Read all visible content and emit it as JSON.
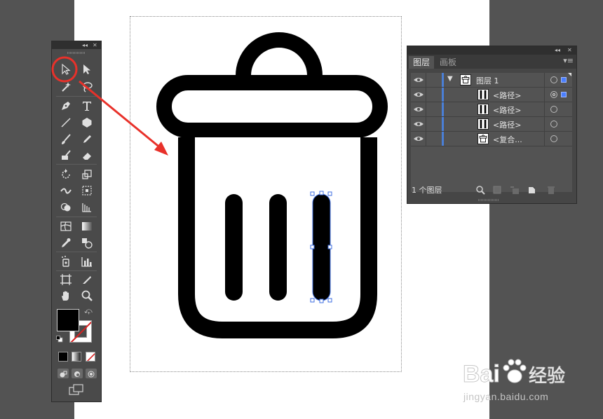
{
  "tools_panel": {
    "collapse_glyph": "◂◂",
    "close_glyph": "✕",
    "tools": [
      {
        "name": "selection-tool",
        "icon": "arrow-pointer"
      },
      {
        "name": "direct-selection-tool",
        "icon": "white-arrow"
      },
      {
        "name": "magic-wand-tool",
        "icon": "wand"
      },
      {
        "name": "lasso-tool",
        "icon": "lasso"
      },
      {
        "name": "pen-tool",
        "icon": "pen-nib"
      },
      {
        "name": "type-tool",
        "icon": "T"
      },
      {
        "name": "line-tool",
        "icon": "line"
      },
      {
        "name": "polygon-tool",
        "icon": "hexagon"
      },
      {
        "name": "paintbrush-tool",
        "icon": "brush"
      },
      {
        "name": "pencil-tool",
        "icon": "pencil"
      },
      {
        "name": "blob-brush-tool",
        "icon": "blob-brush"
      },
      {
        "name": "eraser-tool",
        "icon": "eraser"
      },
      {
        "name": "rotate-tool",
        "icon": "rotate"
      },
      {
        "name": "scale-tool",
        "icon": "scale"
      },
      {
        "name": "width-tool",
        "icon": "width"
      },
      {
        "name": "free-transform-tool",
        "icon": "free-transform"
      },
      {
        "name": "shape-builder-tool",
        "icon": "shape-builder"
      },
      {
        "name": "perspective-grid-tool",
        "icon": "perspective-grid"
      },
      {
        "name": "mesh-tool",
        "icon": "mesh"
      },
      {
        "name": "gradient-tool",
        "icon": "gradient"
      },
      {
        "name": "eyedropper-tool",
        "icon": "eyedropper"
      },
      {
        "name": "blend-tool",
        "icon": "blend"
      },
      {
        "name": "symbol-sprayer-tool",
        "icon": "symbol-sprayer"
      },
      {
        "name": "column-graph-tool",
        "icon": "column-graph"
      },
      {
        "name": "artboard-tool",
        "icon": "artboard"
      },
      {
        "name": "slice-tool",
        "icon": "slice"
      },
      {
        "name": "hand-tool",
        "icon": "hand"
      },
      {
        "name": "zoom-tool",
        "icon": "magnifier"
      }
    ],
    "fill_color": "#000000",
    "stroke_color": "none"
  },
  "layers_panel": {
    "collapse_glyph": "◂◂",
    "close_glyph": "✕",
    "tabs": [
      {
        "label": "图层",
        "active": true
      },
      {
        "label": "画板",
        "active": false
      }
    ],
    "menu_glyph": "▾≡",
    "rows": [
      {
        "name": "图层 1",
        "kind": "layer",
        "expanded": true,
        "thumb": "trash-can",
        "selected_indicator": true
      },
      {
        "name": "<路径>",
        "kind": "path",
        "thumb": "bar",
        "targeted": true,
        "selected_indicator": true
      },
      {
        "name": "<路径>",
        "kind": "path",
        "thumb": "bar",
        "targeted": false,
        "selected_indicator": false
      },
      {
        "name": "<路径>",
        "kind": "path",
        "thumb": "bar",
        "targeted": false,
        "selected_indicator": false
      },
      {
        "name": "<复合...",
        "kind": "compound-path",
        "thumb": "trash-can",
        "targeted": false,
        "selected_indicator": false
      }
    ],
    "footer": {
      "layer_count": "1 个图层"
    }
  },
  "colors": {
    "workspace": "#535353",
    "artboard": "#ffffff",
    "annotation_red": "#e8312a",
    "selection_blue": "#3d6ee0",
    "layer_color": "#4a7fd6"
  },
  "watermark": {
    "brand": "Bai 经验",
    "url": "jingyan.baidu.com"
  }
}
